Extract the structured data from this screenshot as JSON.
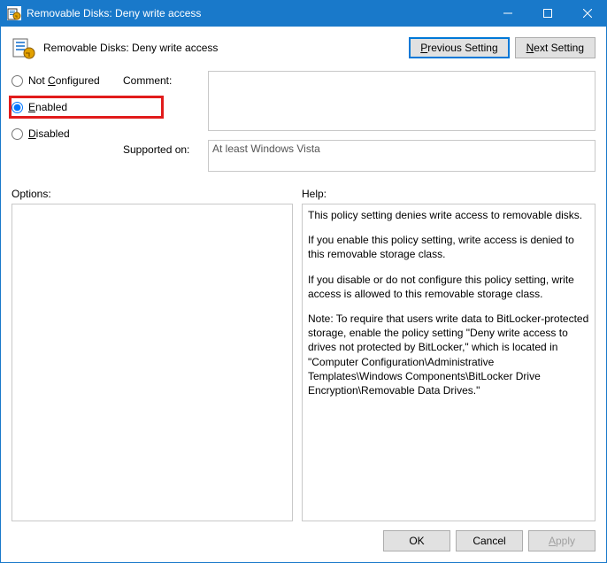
{
  "window": {
    "title": "Removable Disks: Deny write access"
  },
  "header": {
    "page_title": "Removable Disks: Deny write access",
    "prev_label_pre": "P",
    "prev_label_rest": "revious Setting",
    "next_label_pre": "N",
    "next_label_rest": "ext Setting"
  },
  "state": {
    "not_configured_pre": "Not ",
    "not_configured_u": "C",
    "not_configured_rest": "onfigured",
    "enabled_u": "E",
    "enabled_rest": "nabled",
    "disabled_u": "D",
    "disabled_rest": "isabled",
    "selected": "enabled"
  },
  "labels": {
    "comment": "Comment:",
    "supported": "Supported on:",
    "options": "Options:",
    "help": "Help:"
  },
  "fields": {
    "comment_value": "",
    "supported_value": "At least Windows Vista"
  },
  "help": {
    "p1": "This policy setting denies write access to removable disks.",
    "p2": "If you enable this policy setting, write access is denied to this removable storage class.",
    "p3": "If you disable or do not configure this policy setting, write access is allowed to this removable storage class.",
    "p4": "Note: To require that users write data to BitLocker-protected storage, enable the policy setting \"Deny write access to drives not protected by BitLocker,\" which is located in \"Computer Configuration\\Administrative Templates\\Windows Components\\BitLocker Drive Encryption\\Removable Data Drives.\""
  },
  "footer": {
    "ok": "OK",
    "cancel": "Cancel",
    "apply_u": "A",
    "apply_rest": "pply"
  }
}
